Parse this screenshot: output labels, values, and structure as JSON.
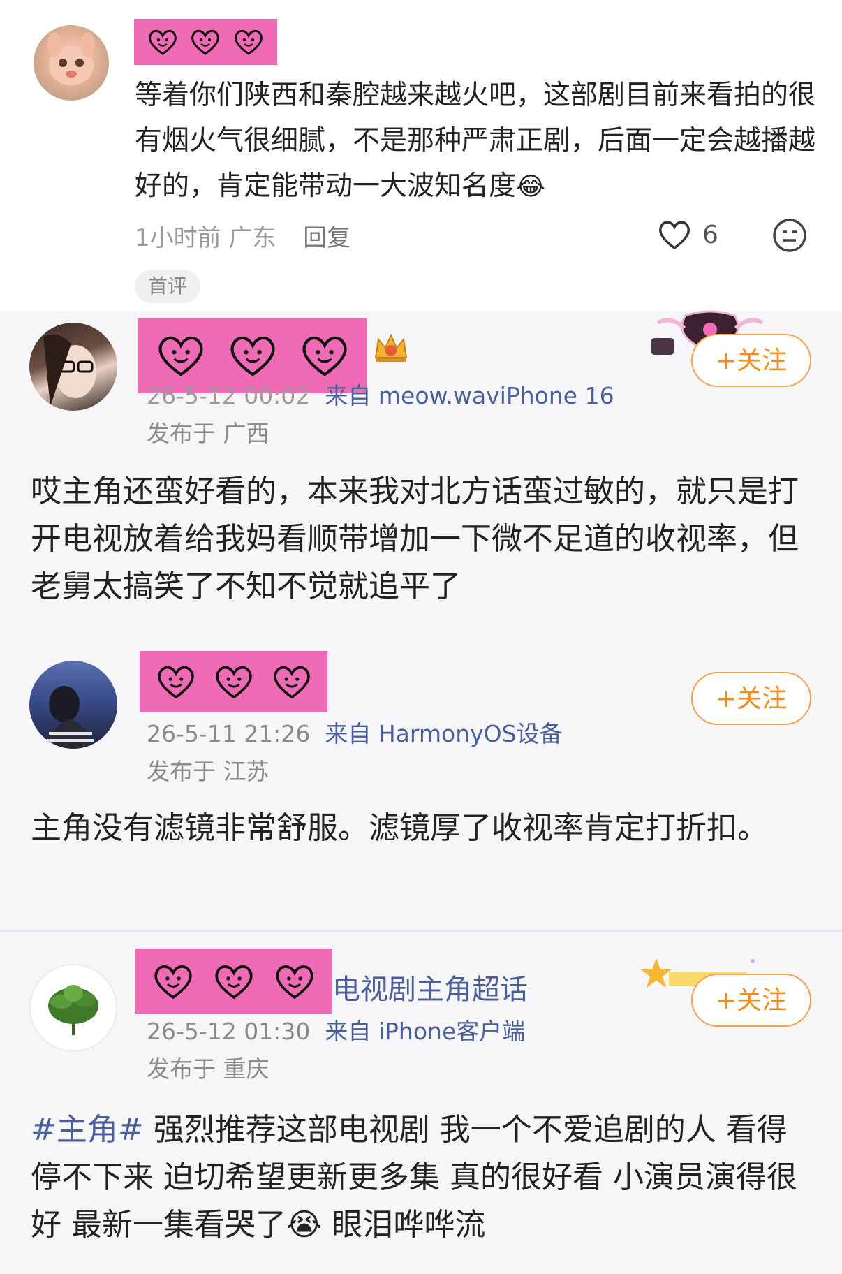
{
  "post": {
    "text": "等着你们陕西和秦腔越来越火吧，这部剧目前来看拍的很有烟火气很细腻，不是那种严肃正剧，后面一定会越播越好的，肯定能带动一大波知名度",
    "time": "1小时前",
    "location": "广东",
    "reply_label": "回复",
    "like_count": "6",
    "first_tag": "首评"
  },
  "comments": [
    {
      "time": "26-5-12 00:02",
      "source": "来自 meow.waviPhone 16",
      "location": "发布于 广西",
      "follow_label": "+关注",
      "text": "哎主角还蛮好看的，本来我对北方话蛮过敏的，就只是打开电视放着给我妈看顺带增加一下微不足道的收视率，但老舅太搞笑了不知不觉就追平了"
    },
    {
      "time": "26-5-11 21:26",
      "source": "来自 HarmonyOS设备",
      "location": "发布于 江苏",
      "follow_label": "+关注",
      "text": "主角没有滤镜非常舒服。滤镜厚了收视率肯定打折扣。"
    },
    {
      "name_extra": "电视剧主角超话",
      "time": "26-5-12 01:30",
      "source": "来自 iPhone客户端",
      "location": "发布于 重庆",
      "follow_label": "+关注",
      "hashtag": "#主角#",
      "text_a": " 强烈推荐这部电视剧 我一个不爱追剧的人 看得停不下来 迫切希望更新更多集 真的很好看 小演员演得很好 最新一集看哭了",
      "text_b": " 眼泪哗哗流"
    }
  ]
}
